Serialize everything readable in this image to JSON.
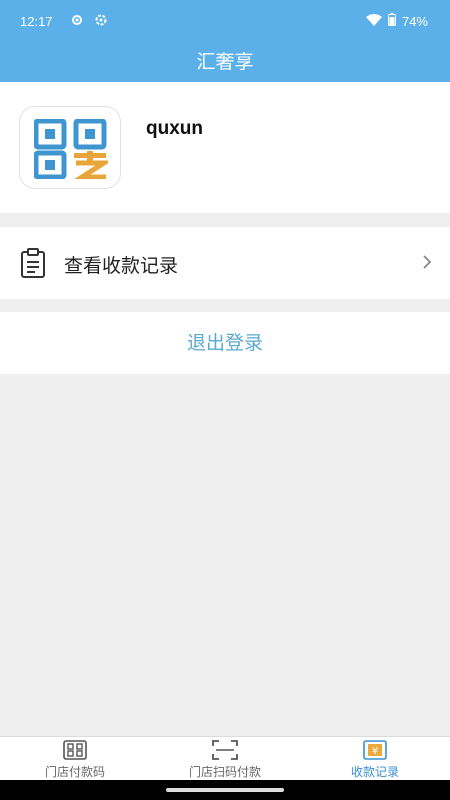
{
  "status_bar": {
    "time": "12:17",
    "battery": "74%"
  },
  "header": {
    "title": "汇奢享"
  },
  "profile": {
    "username": "quxun",
    "logo_icon": "qr-pay-logo"
  },
  "menu": {
    "records_label": "查看收款记录",
    "logout_label": "退出登录"
  },
  "tabs": [
    {
      "label": "门店付款码",
      "icon": "qr-grid-icon",
      "active": false
    },
    {
      "label": "门店扫码付款",
      "icon": "scan-frame-icon",
      "active": false
    },
    {
      "label": "收款记录",
      "icon": "yen-receipt-icon",
      "active": true
    }
  ],
  "colors": {
    "primary": "#5bb0ea",
    "active_tab": "#3a8fd6",
    "logout_text": "#5aa9cf"
  }
}
